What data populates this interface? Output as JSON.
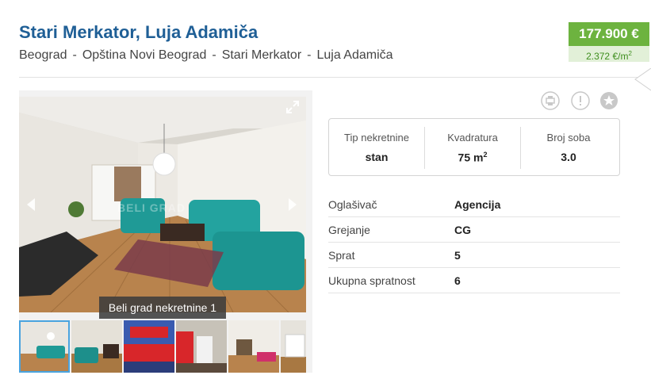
{
  "listing": {
    "title": "Stari Merkator, Luja Adamiča",
    "breadcrumb": [
      "Beograd",
      "Opština Novi Beograd",
      "Stari Merkator",
      "Luja Adamiča"
    ],
    "breadcrumb_separator": "-",
    "price": "177.900 €",
    "price_per_m2_value": "2.372 €/m",
    "price_per_m2_exp": "2"
  },
  "gallery": {
    "caption": "Beli grad nekretnine 1",
    "watermark": "BELI GRAD",
    "thumbnail_count": 6,
    "active_thumbnail": 1
  },
  "actions": {
    "icons": [
      "print-icon",
      "report-icon",
      "favorite-star-icon"
    ]
  },
  "facts": [
    {
      "label": "Tip nekretnine",
      "value": "stan"
    },
    {
      "label": "Kvadratura",
      "value": "75 m",
      "exp": "2"
    },
    {
      "label": "Broj soba",
      "value": "3.0"
    }
  ],
  "details": [
    {
      "key": "Oglašivač",
      "value": "Agencija"
    },
    {
      "key": "Grejanje",
      "value": "CG"
    },
    {
      "key": "Sprat",
      "value": "5"
    },
    {
      "key": "Ukupna spratnost",
      "value": "6"
    }
  ],
  "colors": {
    "title": "#1f5f96",
    "price_bg": "#6db33f",
    "price_per_m2_bg": "#e2f0d8",
    "thumb_active_border": "#4aa3df"
  }
}
